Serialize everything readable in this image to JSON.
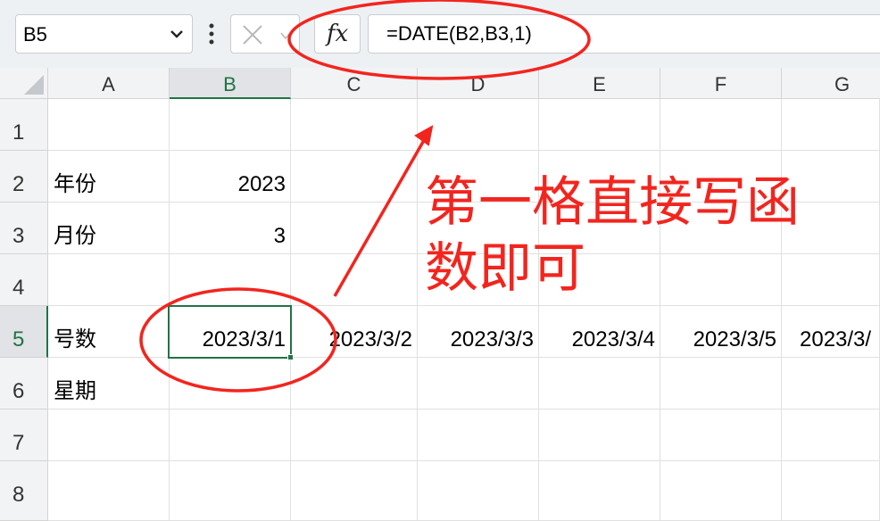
{
  "name_box": {
    "value": "B5"
  },
  "formula_bar": {
    "fx_label": "fx",
    "formula": "=DATE(B2,B3,1)"
  },
  "columns": [
    "A",
    "B",
    "C",
    "D",
    "E",
    "F",
    "G"
  ],
  "rows": [
    "1",
    "2",
    "3",
    "4",
    "5",
    "6",
    "7",
    "8"
  ],
  "cells": {
    "A2": "年份",
    "B2": "2023",
    "A3": "月份",
    "B3": "3",
    "A5": "号数",
    "B5": "2023/3/1",
    "C5": "2023/3/2",
    "D5": "2023/3/3",
    "E5": "2023/3/4",
    "F5": "2023/3/5",
    "G5": "2023/3/",
    "A6": "星期"
  },
  "annotation": {
    "text": "第一格直接写函数即可",
    "color": "#f2251e"
  },
  "colors": {
    "accent": "#217346",
    "annotation_red": "#f2251e"
  },
  "icons": [
    "dropdown-chevron-icon",
    "more-vertical-icon",
    "cancel-x-icon",
    "chevron-down-icon",
    "fx-icon",
    "select-all-triangle-icon"
  ]
}
